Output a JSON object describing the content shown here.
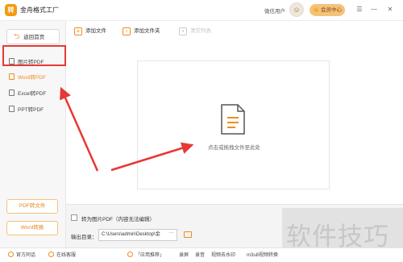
{
  "app": {
    "logo_glyph": "转",
    "title": "金舟格式工厂",
    "user_label": "微信用户",
    "avatar_glyph": "☺",
    "vip_label": "👑 会员中心"
  },
  "window_controls": {
    "menu": "☰",
    "minimize": "—",
    "close": "✕"
  },
  "sidebar": {
    "home_button": "返回首页",
    "items": [
      {
        "label": "图片转PDF"
      },
      {
        "label": "Word转PDF"
      },
      {
        "label": "Excel转PDF"
      },
      {
        "label": "PPT转PDF"
      }
    ],
    "buttons": [
      {
        "label": "PDF转文件"
      },
      {
        "label": "Word转换"
      }
    ]
  },
  "toolbar": {
    "add_file": "添加文件",
    "add_folder": "添加文件夹",
    "clear_list": "清空列表"
  },
  "dropzone": {
    "hint": "点击或拖拽文件至此处"
  },
  "options": {
    "to_image_pdf": "转为图片PDF（内容无法编辑）",
    "output_label": "输出目录：",
    "output_path": "C:\\Users\\admin\\Desktop\\金",
    "more": "···"
  },
  "statusbar": {
    "qq_group": "官方同话",
    "service": "在线客服",
    "recommend": "「应用推荐」",
    "items": [
      "录屏",
      "录音",
      "视频去水印",
      "m3u8视频转换"
    ]
  },
  "watermark": {
    "text": "软件技巧"
  },
  "colors": {
    "accent": "#f08c1e",
    "highlight_box": "#e53935",
    "arrow": "#e53935"
  }
}
